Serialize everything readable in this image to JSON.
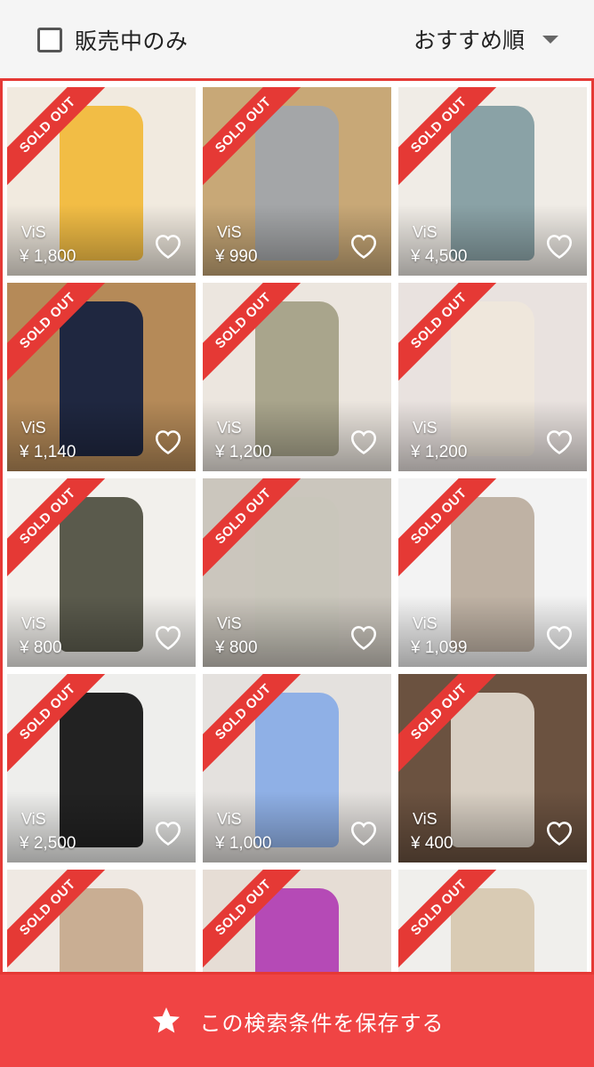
{
  "filter": {
    "label": "販売中のみ",
    "checked": false
  },
  "sort": {
    "label": "おすすめ順"
  },
  "badge_text": "SOLD OUT",
  "colors": {
    "accent": "#e53935",
    "save_bar": "#f04444"
  },
  "items": [
    {
      "brand": "ViS",
      "price": "¥ 1,800",
      "sold_out": true,
      "bg": "#f1eadf",
      "fg": "#f2bd45"
    },
    {
      "brand": "ViS",
      "price": "¥ 990",
      "sold_out": true,
      "bg": "#c8a877",
      "fg": "#a4a6a8"
    },
    {
      "brand": "ViS",
      "price": "¥ 4,500",
      "sold_out": true,
      "bg": "#f0ece6",
      "fg": "#8aa2a6"
    },
    {
      "brand": "ViS",
      "price": "¥ 1,140",
      "sold_out": true,
      "bg": "#b58a58",
      "fg": "#1f2740"
    },
    {
      "brand": "ViS",
      "price": "¥ 1,200",
      "sold_out": true,
      "bg": "#ece6df",
      "fg": "#a9a58c"
    },
    {
      "brand": "ViS",
      "price": "¥ 1,200",
      "sold_out": true,
      "bg": "#e9e2df",
      "fg": "#efe7dc"
    },
    {
      "brand": "ViS",
      "price": "¥ 800",
      "sold_out": true,
      "bg": "#f2f0ec",
      "fg": "#5a5a4c"
    },
    {
      "brand": "ViS",
      "price": "¥ 800",
      "sold_out": true,
      "bg": "#cbc6bd",
      "fg": "#c9c6bb"
    },
    {
      "brand": "ViS",
      "price": "¥ 1,099",
      "sold_out": true,
      "bg": "#f3f3f3",
      "fg": "#bfb2a4"
    },
    {
      "brand": "ViS",
      "price": "¥ 2,500",
      "sold_out": true,
      "bg": "#eeeeec",
      "fg": "#222222"
    },
    {
      "brand": "ViS",
      "price": "¥ 1,000",
      "sold_out": true,
      "bg": "#e4e1de",
      "fg": "#8fb0e6"
    },
    {
      "brand": "ViS",
      "price": "¥ 400",
      "sold_out": true,
      "bg": "#6b5240",
      "fg": "#d8cfc3"
    },
    {
      "brand": "",
      "price": "",
      "sold_out": true,
      "bg": "#efe9e3",
      "fg": "#c9ae93"
    },
    {
      "brand": "",
      "price": "",
      "sold_out": true,
      "bg": "#e6ddd5",
      "fg": "#b54ab6"
    },
    {
      "brand": "",
      "price": "",
      "sold_out": true,
      "bg": "#f0efec",
      "fg": "#d9cbb4"
    }
  ],
  "save_button": {
    "label": "この検索条件を保存する",
    "icon": "star-icon"
  }
}
